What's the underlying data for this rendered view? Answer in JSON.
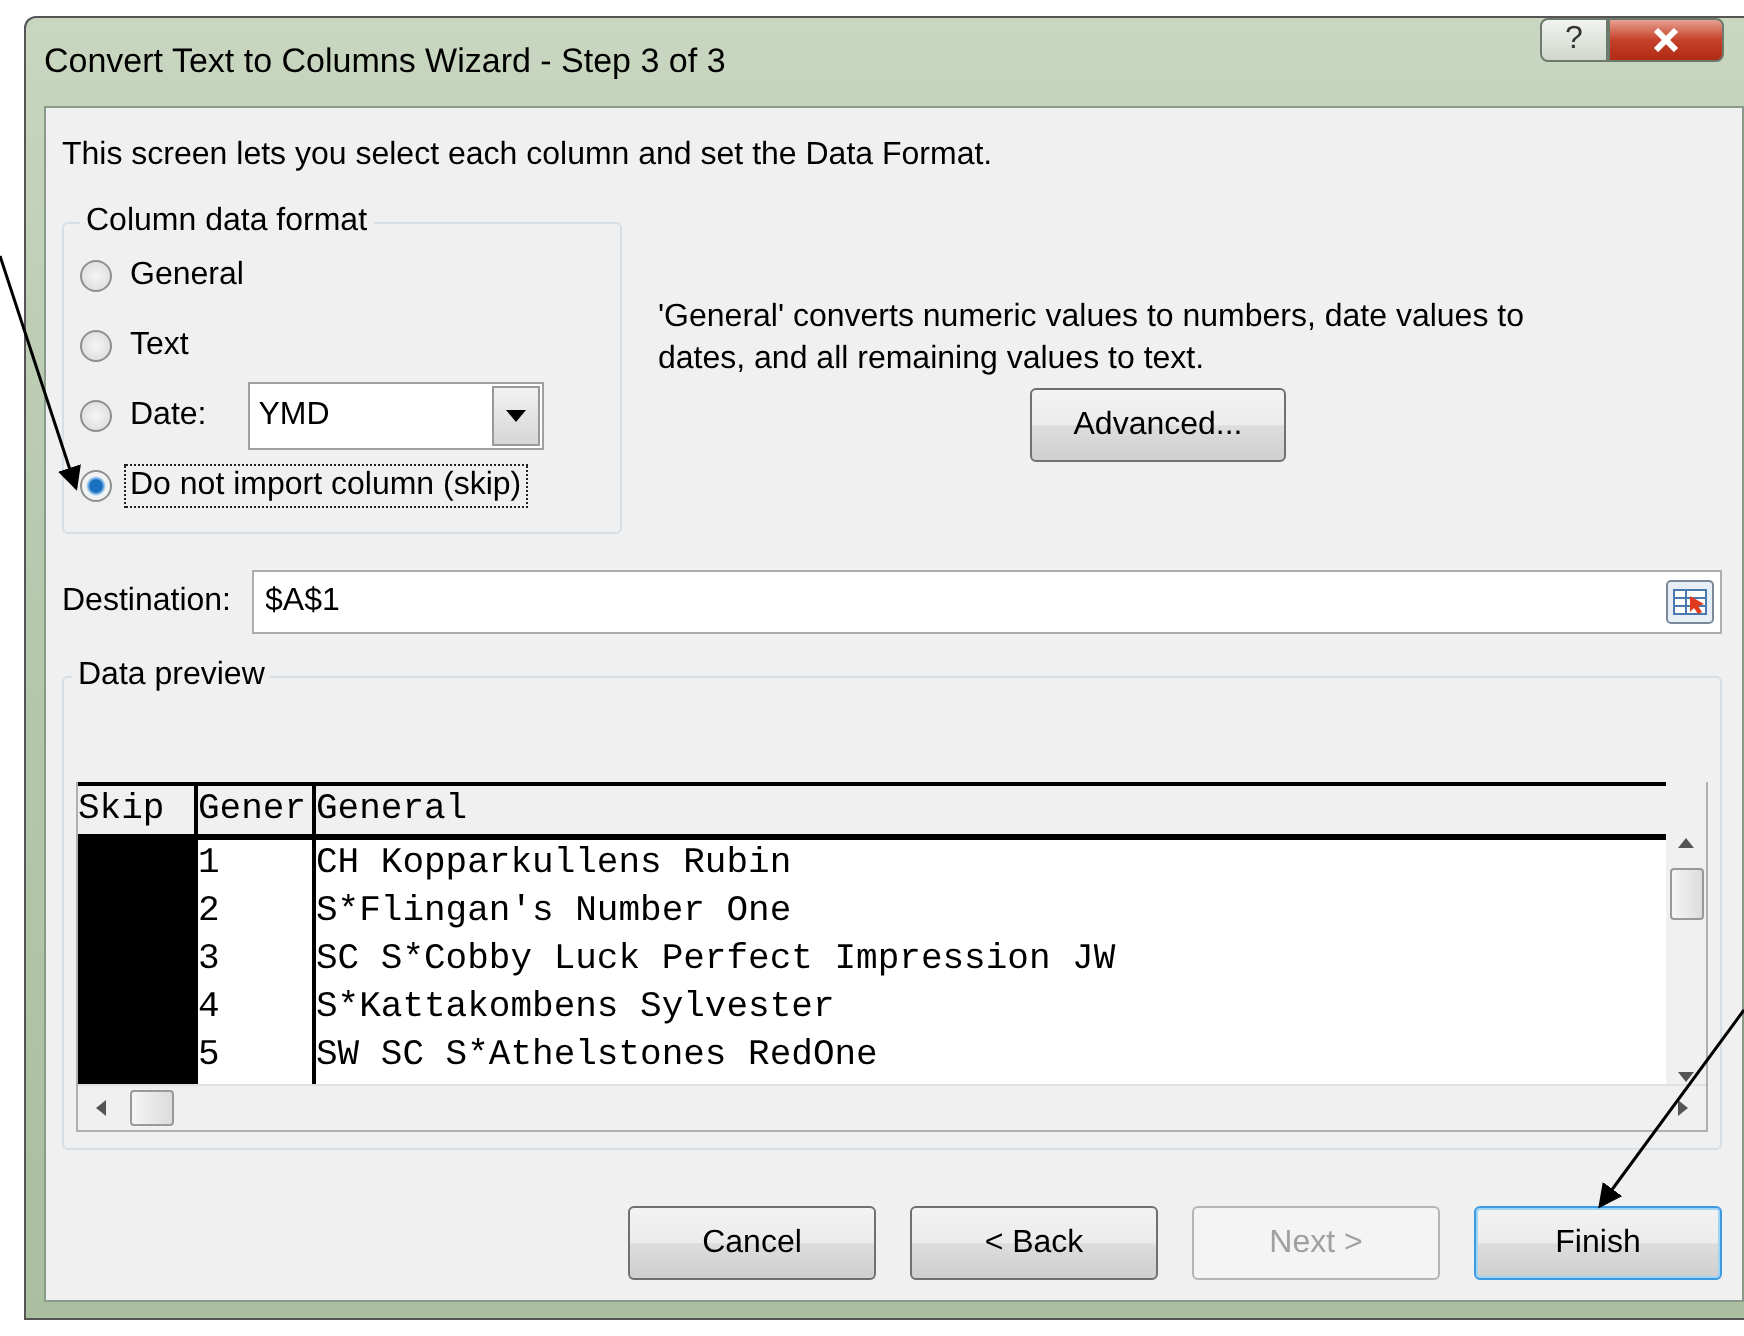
{
  "window": {
    "title": "Convert Text to Columns Wizard - Step 3 of 3",
    "help_button": "?"
  },
  "description": "This screen lets you select each column and set the Data Format.",
  "column_data_format": {
    "legend": "Column data format",
    "options": [
      {
        "label": "General",
        "kind": "plain",
        "selected": false,
        "focused": false
      },
      {
        "label": "Text",
        "kind": "plain",
        "selected": false,
        "focused": false
      },
      {
        "label": "Date:",
        "kind": "date",
        "selected": false,
        "focused": false,
        "dropdown_value": "YMD"
      },
      {
        "label": "Do not import column (skip)",
        "kind": "plain",
        "selected": true,
        "focused": true
      }
    ]
  },
  "info_text": "'General' converts numeric values to numbers, date values to dates, and all remaining values to text.",
  "advanced_button": "Advanced...",
  "destination": {
    "label": "Destination:",
    "value": "$A$1"
  },
  "data_preview": {
    "legend": "Data preview",
    "columns": [
      {
        "label": "Skip",
        "selected": true
      },
      {
        "label": "Gener",
        "selected": false
      },
      {
        "label": "General",
        "selected": false
      }
    ],
    "rows": [
      {
        "cells": [
          "",
          "1",
          "CH Kopparkullens Rubin"
        ]
      },
      {
        "cells": [
          "",
          "2",
          "S*Flingan's Number One"
        ]
      },
      {
        "cells": [
          "",
          "3",
          "SC S*Cobby Luck Perfect Impression JW"
        ]
      },
      {
        "cells": [
          "",
          "4",
          "S*Kattakombens Sylvester"
        ]
      },
      {
        "cells": [
          "",
          "5",
          "SW SC S*Athelstones RedOne"
        ]
      }
    ]
  },
  "buttons": [
    {
      "label": "Cancel",
      "disabled": false,
      "default": false
    },
    {
      "label": "< Back",
      "disabled": false,
      "default": false
    },
    {
      "label": "Next >",
      "disabled": true,
      "default": false
    },
    {
      "label": "Finish",
      "disabled": false,
      "default": true
    }
  ]
}
